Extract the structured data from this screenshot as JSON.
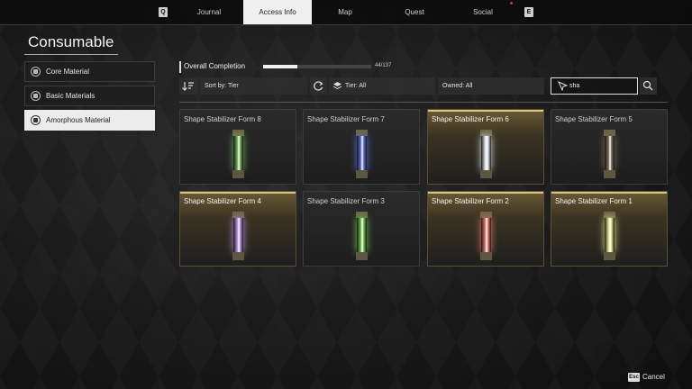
{
  "topnav": {
    "left_key": "Q",
    "right_key": "E",
    "tabs": [
      {
        "label": "Journal"
      },
      {
        "label": "Access Info"
      },
      {
        "label": "Map"
      },
      {
        "label": "Quest"
      },
      {
        "label": "Social"
      }
    ],
    "active_tab": "Access Info"
  },
  "sidebar": {
    "title": "Consumable",
    "items": [
      {
        "label": "Core Material",
        "icon": "hexagon-icon"
      },
      {
        "label": "Basic Materials",
        "icon": "hexagon-icon"
      },
      {
        "label": "Amorphous Material",
        "icon": "gear-icon"
      }
    ],
    "active_item": "Amorphous Material"
  },
  "completion": {
    "label": "Overall Completion",
    "count": "44/137",
    "progress": 0.32
  },
  "toolbar": {
    "sort_label": "Sort by: Tier",
    "tier_label": "Tier: All",
    "owned_label": "Owned: All",
    "search_value": "sha"
  },
  "items": [
    {
      "name": "Shape Stabilizer Form 8",
      "color": "#6fae5a",
      "highlight": false
    },
    {
      "name": "Shape Stabilizer Form 7",
      "color": "#5b6fd6",
      "highlight": false
    },
    {
      "name": "Shape Stabilizer Form 6",
      "color": "#d7dbe2",
      "highlight": true
    },
    {
      "name": "Shape Stabilizer Form 5",
      "color": "#7a6a5a",
      "highlight": false
    },
    {
      "name": "Shape Stabilizer Form 4",
      "color": "#b48ae0",
      "highlight": true
    },
    {
      "name": "Shape Stabilizer Form 3",
      "color": "#6fbf4a",
      "highlight": false
    },
    {
      "name": "Shape Stabilizer Form 2",
      "color": "#e0706a",
      "highlight": true
    },
    {
      "name": "Shape Stabilizer Form 1",
      "color": "#dbe08a",
      "highlight": true
    }
  ],
  "footer": {
    "esc_key": "Esc",
    "cancel_label": "Cancel"
  },
  "colors": {
    "accent_gold": "#d9c48a",
    "active_tab_bg": "#efefef"
  }
}
